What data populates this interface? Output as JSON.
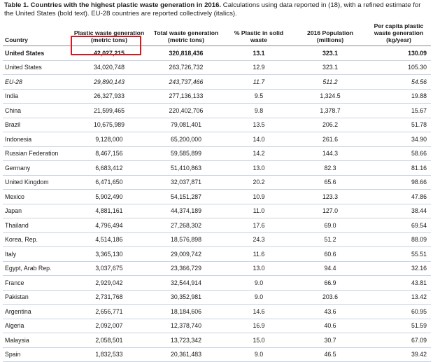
{
  "caption": {
    "title": "Table 1. Countries with the highest plastic waste generation in 2016.",
    "body": " Calculations using data reported in (18), with a refined estimate for the United States (bold text). EU-28 countries are reported collectively (italics)."
  },
  "headers": [
    "Country",
    "Plastic waste generation (metric tons)",
    "Total waste generation (metric tons)",
    "% Plastic in solid waste",
    "2016 Population (millions)",
    "Per capita plastic waste generation (kg/year)"
  ],
  "rows": [
    {
      "style": "bold",
      "cells": [
        "United States",
        "42,027,215",
        "320,818,436",
        "13.1",
        "323.1",
        "130.09"
      ]
    },
    {
      "style": "",
      "cells": [
        "United States",
        "34,020,748",
        "263,726,732",
        "12.9",
        "323.1",
        "105.30"
      ]
    },
    {
      "style": "ital",
      "cells": [
        "EU-28",
        "29,890,143",
        "243,737,466",
        "11.7",
        "511.2",
        "54.56"
      ]
    },
    {
      "style": "",
      "cells": [
        "India",
        "26,327,933",
        "277,136,133",
        "9.5",
        "1,324.5",
        "19.88"
      ]
    },
    {
      "style": "",
      "cells": [
        "China",
        "21,599,465",
        "220,402,706",
        "9.8",
        "1,378.7",
        "15.67"
      ]
    },
    {
      "style": "",
      "cells": [
        "Brazil",
        "10,675,989",
        "79,081,401",
        "13.5",
        "206.2",
        "51.78"
      ]
    },
    {
      "style": "",
      "cells": [
        "Indonesia",
        "9,128,000",
        "65,200,000",
        "14.0",
        "261.6",
        "34.90"
      ]
    },
    {
      "style": "",
      "cells": [
        "Russian Federation",
        "8,467,156",
        "59,585,899",
        "14.2",
        "144.3",
        "58.66"
      ]
    },
    {
      "style": "",
      "cells": [
        "Germany",
        "6,683,412",
        "51,410,863",
        "13.0",
        "82.3",
        "81.16"
      ]
    },
    {
      "style": "",
      "cells": [
        "United Kingdom",
        "6,471,650",
        "32,037,871",
        "20.2",
        "65.6",
        "98.66"
      ]
    },
    {
      "style": "",
      "cells": [
        "Mexico",
        "5,902,490",
        "54,151,287",
        "10.9",
        "123.3",
        "47.86"
      ]
    },
    {
      "style": "",
      "cells": [
        "Japan",
        "4,881,161",
        "44,374,189",
        "11.0",
        "127.0",
        "38.44"
      ]
    },
    {
      "style": "",
      "cells": [
        "Thailand",
        "4,796,494",
        "27,268,302",
        "17.6",
        "69.0",
        "69.54"
      ]
    },
    {
      "style": "",
      "cells": [
        "Korea, Rep.",
        "4,514,186",
        "18,576,898",
        "24.3",
        "51.2",
        "88.09"
      ]
    },
    {
      "style": "",
      "cells": [
        "Italy",
        "3,365,130",
        "29,009,742",
        "11.6",
        "60.6",
        "55.51"
      ]
    },
    {
      "style": "",
      "cells": [
        "Egypt, Arab Rep.",
        "3,037,675",
        "23,366,729",
        "13.0",
        "94.4",
        "32.16"
      ]
    },
    {
      "style": "",
      "cells": [
        "France",
        "2,929,042",
        "32,544,914",
        "9.0",
        "66.9",
        "43.81"
      ]
    },
    {
      "style": "",
      "cells": [
        "Pakistan",
        "2,731,768",
        "30,352,981",
        "9.0",
        "203.6",
        "13.42"
      ]
    },
    {
      "style": "",
      "cells": [
        "Argentina",
        "2,656,771",
        "18,184,606",
        "14.6",
        "43.6",
        "60.95"
      ]
    },
    {
      "style": "",
      "cells": [
        "Algeria",
        "2,092,007",
        "12,378,740",
        "16.9",
        "40.6",
        "51.59"
      ]
    },
    {
      "style": "",
      "cells": [
        "Malaysia",
        "2,058,501",
        "13,723,342",
        "15.0",
        "30.7",
        "67.09"
      ]
    },
    {
      "style": "",
      "cells": [
        "Spain",
        "1,832,533",
        "20,361,483",
        "9.0",
        "46.5",
        "39.42"
      ]
    }
  ]
}
